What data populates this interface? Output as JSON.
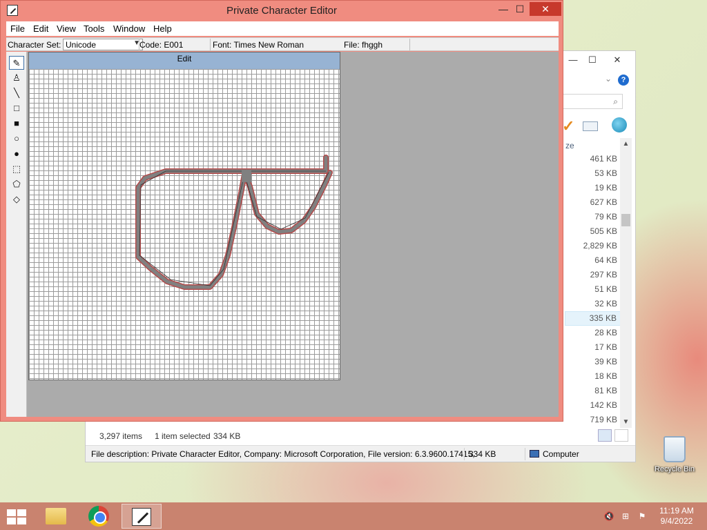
{
  "explorer": {
    "column_header": "ze",
    "sizes": [
      "461 KB",
      "53 KB",
      "19 KB",
      "627 KB",
      "79 KB",
      "505 KB",
      "2,829 KB",
      "64 KB",
      "297 KB",
      "51 KB",
      "32 KB",
      "335 KB",
      "28 KB",
      "17 KB",
      "39 KB",
      "18 KB",
      "81 KB",
      "142 KB",
      "719 KB"
    ],
    "selected_index": 11,
    "status": {
      "items": "3,297 items",
      "selected": "1 item selected",
      "size": "334 KB"
    },
    "details": {
      "description": "File description: Private Character Editor, Company: Microsoft Corporation, File version: 6.3.9600.17415,",
      "size": "334 KB",
      "location": "Computer"
    }
  },
  "pce": {
    "title": "Private Character Editor",
    "menu": [
      "File",
      "Edit",
      "View",
      "Tools",
      "Window",
      "Help"
    ],
    "info": {
      "charset_label": "Character Set:",
      "charset_value": "Unicode",
      "code": "Code: E001",
      "font": "Font: Times New Roman",
      "file": "File: fhggh"
    },
    "edit_title": "Edit",
    "tools": [
      "pencil",
      "brush",
      "line",
      "hollow-rectangle",
      "filled-rectangle",
      "hollow-ellipse",
      "filled-ellipse",
      "rectangular-selection",
      "freeform-selection",
      "eraser"
    ]
  },
  "desktop": {
    "recycle_bin": "Recycle Bin"
  },
  "taskbar": {
    "time": "11:19 AM",
    "date": "9/4/2022"
  },
  "colors": {
    "title_bar": "#f08c80",
    "taskbar": "#c9836f",
    "edit_header": "#97b3d3",
    "drawing_stroke": "#b44a4a",
    "filled_cell": "#808080"
  }
}
